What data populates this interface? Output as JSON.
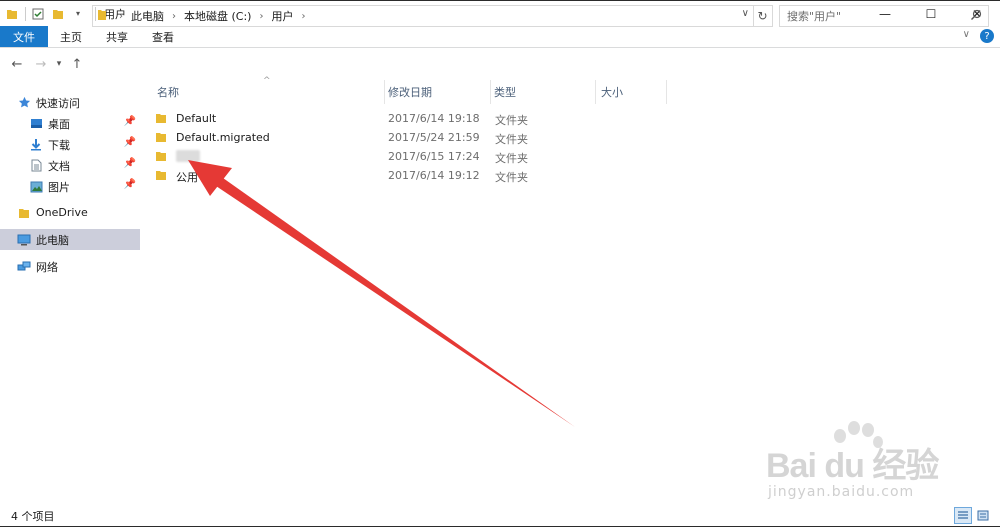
{
  "window": {
    "title": "用户",
    "minimize_glyph": "—",
    "maximize_glyph": "☐",
    "close_glyph": "✕"
  },
  "ribbon": {
    "tabs": [
      "文件",
      "主页",
      "共享",
      "查看"
    ],
    "file_tab_color": "#1979ca"
  },
  "address": {
    "crumbs": [
      "此电脑",
      "本地磁盘 (C:)",
      "用户"
    ],
    "search_placeholder": "搜索\"用户\""
  },
  "sidebar": {
    "quick_access": "快速访问",
    "quick_items": [
      "桌面",
      "下载",
      "文档",
      "图片"
    ],
    "onedrive": "OneDrive",
    "this_pc": "此电脑",
    "network": "网络"
  },
  "columns": {
    "name": "名称",
    "modified": "修改日期",
    "type": "类型",
    "size": "大小"
  },
  "files": [
    {
      "name": "Default",
      "modified": "2017/6/14 19:18",
      "type": "文件夹"
    },
    {
      "name": "Default.migrated",
      "modified": "2017/5/24 21:59",
      "type": "文件夹"
    },
    {
      "name": "",
      "modified": "2017/6/15 17:24",
      "type": "文件夹"
    },
    {
      "name": "公用",
      "modified": "2017/6/14 19:12",
      "type": "文件夹"
    }
  ],
  "status": {
    "item_count": "4 个项目"
  },
  "watermark": {
    "logo_text": "Bai du 经验",
    "site": "jingyan.baidu.com"
  },
  "annotation_color": "#e53935"
}
